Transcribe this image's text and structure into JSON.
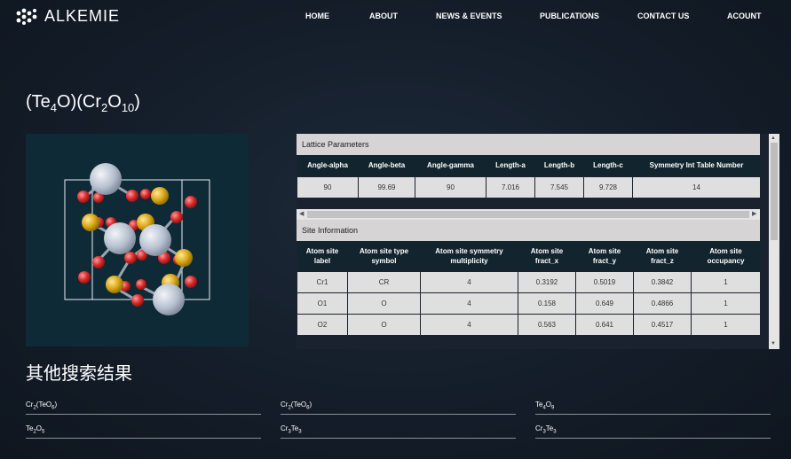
{
  "brand": {
    "name": "ALKEMIE",
    "icon": "alkemie-logo-icon"
  },
  "nav": {
    "home": "HOME",
    "about": "ABOUT",
    "news": "NEWS & EVENTS",
    "publications": "PUBLICATIONS",
    "contact": "CONTACT US",
    "account": "ACOUNT"
  },
  "formula": {
    "p1": "(Te",
    "s1": "4",
    "p2": "O)(Cr",
    "s2": "2",
    "p3": "O",
    "s3": "10",
    "p4": ")"
  },
  "lattice": {
    "title": "Lattice Parameters",
    "headers": [
      "Angle-alpha",
      "Angle-beta",
      "Angle-gamma",
      "Length-a",
      "Length-b",
      "Length-c",
      "Symmetry Int Table Number"
    ],
    "values": [
      "90",
      "99.69",
      "90",
      "7.016",
      "7.545",
      "9.728",
      "14"
    ]
  },
  "site": {
    "title": "Site Information",
    "headers": [
      "Atom site label",
      "Atom site type symbol",
      "Atom site symmetry multiplicity",
      "Atom site fract_x",
      "Atom site fract_y",
      "Atom site fract_z",
      "Atom site occupancy"
    ],
    "rows": [
      [
        "Cr1",
        "CR",
        "4",
        "0.3192",
        "0.5019",
        "0.3842",
        "1"
      ],
      [
        "O1",
        "O",
        "4",
        "0.158",
        "0.649",
        "0.4866",
        "1"
      ],
      [
        "O2",
        "O",
        "4",
        "0.563",
        "0.641",
        "0.4517",
        "1"
      ]
    ]
  },
  "other": {
    "title": "其他搜索结果",
    "results": [
      {
        "a": "Cr",
        "b": "2",
        "c": "(TeO",
        "d": "6",
        "e": ")"
      },
      {
        "a": "Cr",
        "b": "2",
        "c": "(TeO",
        "d": "6",
        "e": ")"
      },
      {
        "a": "Te",
        "b": "4",
        "c": "O",
        "d": "9",
        "e": ""
      },
      {
        "a": "Te",
        "b": "2",
        "c": "O",
        "d": "5",
        "e": ""
      },
      {
        "a": "Cr",
        "b": "3",
        "c": "Te",
        "d": "3",
        "e": ""
      },
      {
        "a": "Cr",
        "b": "3",
        "c": "Te",
        "d": "3",
        "e": ""
      }
    ]
  },
  "colors": {
    "background": "#141d29",
    "viewer": "#0e2a36",
    "header": "#12242e",
    "cell": "#e0dfdf",
    "te_atom": "#c3cbd9",
    "o_atom": "#e03a3a",
    "cr_atom": "#e0b020"
  }
}
